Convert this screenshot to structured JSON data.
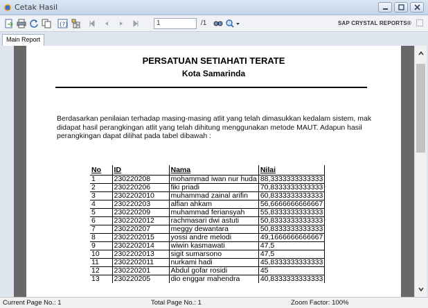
{
  "window": {
    "title": "Cetak Hasil",
    "app_icon": "crystal-reports-app-icon",
    "controls": [
      "minimize-icon",
      "maximize-icon",
      "close-icon"
    ]
  },
  "toolbar": {
    "buttons": [
      "export-icon",
      "print-icon",
      "refresh-icon",
      "copy-icon",
      "help-icon",
      "group-tree-icon",
      "first-page-icon",
      "prev-page-icon",
      "next-page-icon",
      "last-page-icon",
      "find-icon",
      "zoom-icon"
    ],
    "page_input": "1",
    "page_total": "/1",
    "brand": "SAP CRYSTAL REPORTS®"
  },
  "tabs": [
    {
      "label": "Main Report"
    }
  ],
  "report": {
    "title": "PERSATUAN SETIAHATI TERATE",
    "subtitle": "Kota Samarinda",
    "paragraph_lines": [
      "Berdasarkan penilaian terhadap masing-masing atlit yang telah dimasukkan kedalam sistem, mak",
      "didapat hasil perangkingan atlit yang telah dihitung menggunakan metode MAUT. Adapun hasil",
      "perangkingan dapat dilihat pada tabel dibawah :"
    ],
    "table": {
      "headers": [
        "No",
        "ID",
        "Nama",
        "Nilai"
      ],
      "rows": [
        [
          "1",
          "230220208",
          "mohammad iwan nur huda",
          "88,3333333333333"
        ],
        [
          "2",
          "230220206",
          "fiki priadi",
          "70,8333333333333"
        ],
        [
          "3",
          "2302202010",
          "muhammad zainal arifin",
          "60,8333333333333"
        ],
        [
          "4",
          "230220203",
          "alfian ahkam",
          "56,6666666666667"
        ],
        [
          "5",
          "230220209",
          "muhammad feriansyah",
          "55,8333333333333"
        ],
        [
          "6",
          "2302202012",
          "rachmasari dwi astuti",
          "50,8333333333333"
        ],
        [
          "7",
          "230220207",
          "meggy dewantara",
          "50,8333333333333"
        ],
        [
          "8",
          "2302202015",
          "yossi andre melodi",
          "49,1666666666667"
        ],
        [
          "9",
          "2302202014",
          "wiwin kasmawati",
          "47,5"
        ],
        [
          "10",
          "2302202013",
          "sigit sumarsono",
          "47,5"
        ],
        [
          "11",
          "2302202011",
          "nurkami hadi",
          "45,8333333333333"
        ],
        [
          "12",
          "230220201",
          "Abdul gofar rosidi",
          "45"
        ],
        [
          "13",
          "230220205",
          "dio enggar mahendra",
          "40,8333333333333"
        ]
      ]
    }
  },
  "statusbar": {
    "current_page": "Current Page No.: 1",
    "total_page": "Total Page No.: 1",
    "zoom": "Zoom Factor: 100%"
  },
  "colors": {
    "titlebar": "#c5d5e8",
    "viewport_bg": "#686868",
    "page_bg": "#ffffff"
  }
}
